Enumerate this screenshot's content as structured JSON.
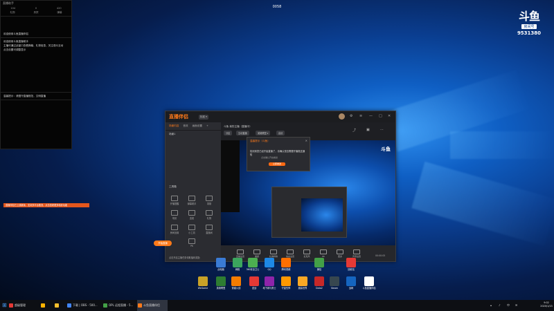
{
  "chat": {
    "header": "直播助手",
    "stats": [
      "104",
      "0",
      "420"
    ],
    "tabs": [
      "礼物",
      "贵宾",
      "弹幕"
    ],
    "messages": [
      "欢迎使用斗鱼直播伴侣",
      "欢迎使用斗鱼直播助手\n主播可通过此窗口查看弹幕、礼物信息，关注观众互动\n点击设置可调整显示",
      "温馨提示：请遵守直播规范，文明直播"
    ]
  },
  "timer": "0058",
  "room_badge": {
    "logo": "斗鱼",
    "label": "房间号",
    "number": "9531380"
  },
  "app": {
    "title": "直播伴侣",
    "version": "标准 ▾",
    "left_tabs": [
      "场景内容",
      "音效",
      "画面设置",
      "+"
    ],
    "scene_item": "场景1",
    "tools_label": "工具箱",
    "tools": [
      "开播提醒",
      "弹幕助手",
      "录制",
      "场景",
      "连麦",
      "礼物",
      "房间设置",
      "小工具",
      "直播间",
      "PK"
    ],
    "orange_notice": "直播伴侣已上线新版，支持多平台推流，点击查看更多精彩功能",
    "footer_notice": "点击开启主播任务领取福利奖励",
    "stage_search": "斗鱼 我的主播（直播中）",
    "stage_pills": [
      "分区",
      "互动直播",
      "英雄联盟 ▾",
      "高清"
    ],
    "dialog": {
      "header": "温馨提示（斗鱼）",
      "text": "检测到您已经开始直播了，请确认是否需要开播推送通知",
      "sub": "点击确认开启推送",
      "button": "立即推送"
    },
    "bottom_tools": [
      "直播设置",
      "美颜",
      "礼物特效",
      "动态设置",
      "麦克风",
      "PK",
      "更多",
      "声音设置"
    ],
    "go_live": "开始直播",
    "status_time": "00:00:05"
  },
  "desktop_icons": [
    {
      "label": "此电脑",
      "color": "#3a7bd5"
    },
    {
      "label": "网络",
      "color": "#3ba55d"
    },
    {
      "label": "360安全卫士",
      "color": "#4caf50"
    },
    {
      "label": "QQ",
      "color": "#1e88e5"
    },
    {
      "label": "腾讯视频",
      "color": "#ff6f00"
    },
    {
      "label": "微信",
      "color": "#43a047"
    },
    {
      "label": "回收站",
      "color": "#e53935"
    },
    {
      "label": "WeGame",
      "color": "#c9a227"
    },
    {
      "label": "英雄联盟",
      "color": "#2e7d32"
    },
    {
      "label": "穿越火线",
      "color": "#f57c00"
    },
    {
      "label": "逆战",
      "color": "#e53935"
    },
    {
      "label": "地下城与勇士",
      "color": "#8e24aa"
    },
    {
      "label": "守望先锋",
      "color": "#ff9800"
    },
    {
      "label": "魔兽世界",
      "color": "#f9a825"
    },
    {
      "label": "Dota2",
      "color": "#c62828"
    },
    {
      "label": "Steam",
      "color": "#37474f"
    },
    {
      "label": "战网",
      "color": "#1565c0"
    },
    {
      "label": "斗鱼直播伴侣",
      "color": "#ffffff"
    }
  ],
  "taskbar": {
    "items": [
      {
        "label": "超级管理",
        "color": "#e53935"
      },
      {
        "label": "",
        "color": "#ffb300"
      },
      {
        "label": "",
        "color": "#fbc02d"
      },
      {
        "label": "下载 | OBS - 500...",
        "color": "#4285f4"
      },
      {
        "label": "OPL 远程直播 - 5...",
        "color": "#43a047"
      },
      {
        "label": "斗鱼直播伴侣",
        "color": "#ff7a1a"
      }
    ],
    "clock_time": "9:02",
    "clock_date": "2020/1/13"
  }
}
